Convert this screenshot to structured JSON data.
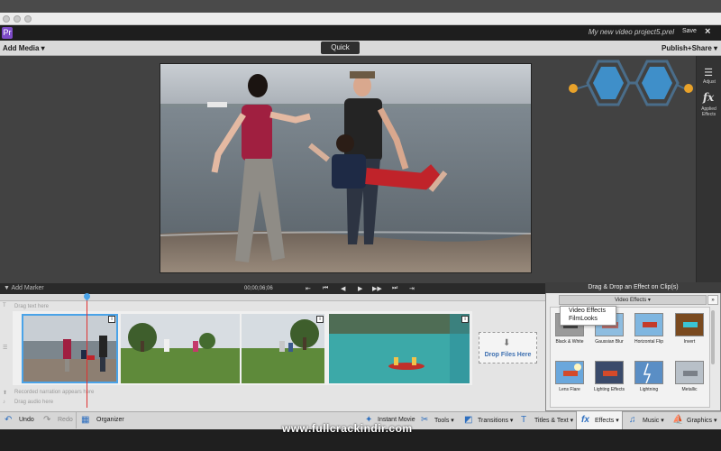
{
  "window": {
    "project_name": "My new video project5.prel"
  },
  "app": {
    "logo": "Pr",
    "save_label": "Save",
    "close_label": "×"
  },
  "modebar": {
    "add_media": "Add Media ▾",
    "quick": "Quick",
    "publish": "Publish+Share ▾"
  },
  "right_panel": {
    "adjust": "Adjust",
    "applied_effects_line1": "Applied",
    "applied_effects_line2": "Effects",
    "fx_symbol": "fx"
  },
  "timeline": {
    "add_marker": "▼ Add Marker",
    "timecode": "00;00;06;06",
    "controls": [
      "⇤",
      "⏮",
      "◀",
      "▶",
      "▶▶",
      "⏭",
      "⇥"
    ],
    "drag_text": "Drag text here",
    "narration": "Recorded narration appears here",
    "drag_audio": "Drag audio here",
    "drop_files": "Drop Files Here",
    "track_icons": [
      "T",
      "☰"
    ]
  },
  "fx_panel": {
    "title": "Drag & Drop an Effect on Clip(s)",
    "category": "Video Effects ▾",
    "expand": "»",
    "menu": [
      "Video Effects",
      "FilmLooks"
    ],
    "effects": [
      "Black & White",
      "Gaussian Blur",
      "Horizontal Flip",
      "Invert",
      "Lens Flare",
      "Lighting Effects",
      "Lightning",
      "Metallic"
    ]
  },
  "toolbar": {
    "undo": "Undo",
    "redo": "Redo",
    "organizer": "Organizer",
    "instant_movie": "Instant Movie",
    "tools": "Tools ▾",
    "transitions": "Transitions ▾",
    "titles": "Titles & Text ▾",
    "effects": "Effects ▾",
    "music": "Music ▾",
    "graphics": "Graphics ▾"
  },
  "watermark": "www.fullcrackindir.com",
  "colors": {
    "accent": "#4aa3e8",
    "playhead": "#e03030",
    "logo": "#7d4bc7",
    "drop_text": "#3d6fb0"
  }
}
